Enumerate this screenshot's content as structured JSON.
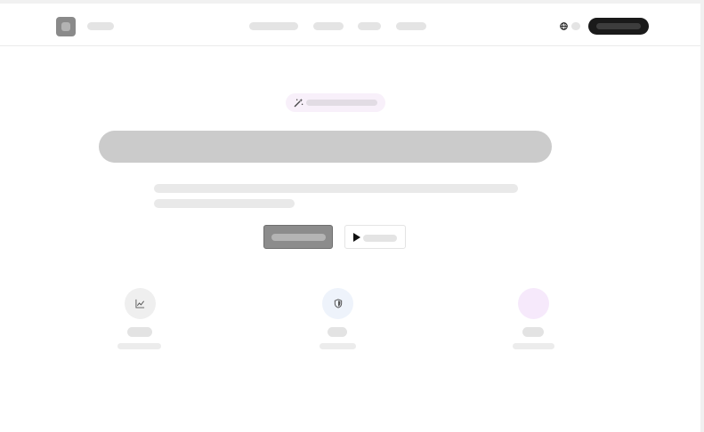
{
  "icons": {
    "logo": "logo-mark",
    "language": "globe-icon",
    "badge": "magic-wand-icon",
    "video": "play-icon",
    "features": [
      "chart-line-icon",
      "shield-icon",
      "sparkle-icon"
    ]
  },
  "colors": {
    "primary": "#8c8c8c",
    "cta": "#1a1a1a",
    "badge_bg": "#f8f0fa",
    "feature_1_bg": "#efefef",
    "feature_2_bg": "#eef3fb",
    "feature_3_bg": "#f6e9fb"
  }
}
